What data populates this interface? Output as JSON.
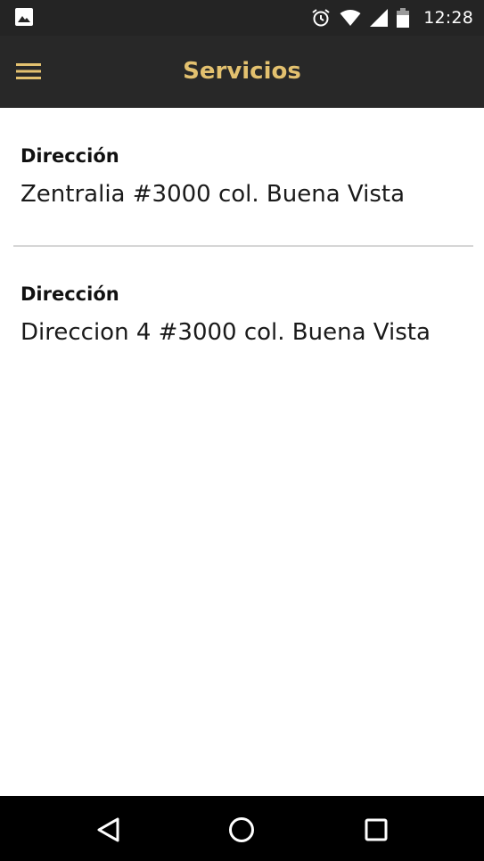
{
  "status_bar": {
    "time": "12:28",
    "icons": [
      "gallery-icon",
      "alarm-icon",
      "wifi-icon",
      "signal-icon",
      "battery-icon"
    ]
  },
  "app_bar": {
    "title": "Servicios",
    "menu_icon": "hamburger-menu-icon",
    "accent_color": "#e3c16f",
    "background_color": "#282828"
  },
  "addresses": [
    {
      "label": "Dirección",
      "value": "Zentralia #3000 col. Buena Vista"
    },
    {
      "label": "Dirección",
      "value": "Direccion 4 #3000 col. Buena Vista"
    }
  ],
  "nav_bar": {
    "buttons": [
      "back-icon",
      "home-icon",
      "recents-icon"
    ]
  }
}
